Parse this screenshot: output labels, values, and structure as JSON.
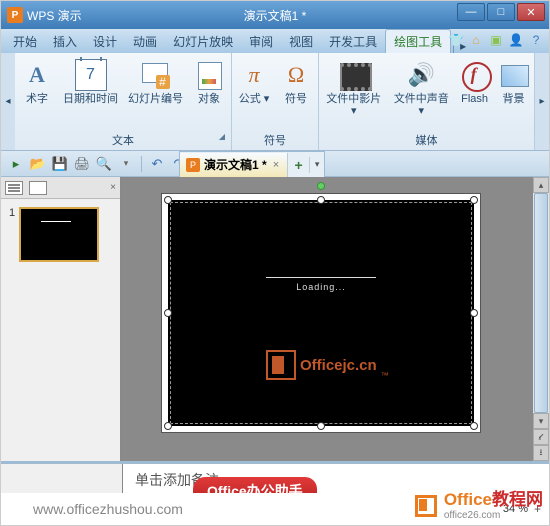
{
  "titlebar": {
    "app_name": "WPS 演示",
    "doc_title": "演示文稿1 *"
  },
  "tabs": {
    "items": [
      {
        "label": "开始",
        "active": false
      },
      {
        "label": "插入",
        "active": false
      },
      {
        "label": "设计",
        "active": false
      },
      {
        "label": "动画",
        "active": false
      },
      {
        "label": "幻灯片放映",
        "active": false
      },
      {
        "label": "审阅",
        "active": false
      },
      {
        "label": "视图",
        "active": false
      },
      {
        "label": "开发工具",
        "active": false
      },
      {
        "label": "绘图工具",
        "active": true
      }
    ]
  },
  "ribbon": {
    "groups": [
      {
        "label": "文本",
        "items": [
          {
            "icon": "textA",
            "label": "术字",
            "name": "wordart-button"
          },
          {
            "icon": "cal7",
            "label": "日期和时间",
            "name": "date-time-button"
          },
          {
            "icon": "slidenum",
            "label": "幻灯片编号",
            "name": "slide-number-button"
          },
          {
            "icon": "obj",
            "label": "对象",
            "name": "object-button"
          }
        ]
      },
      {
        "label": "符号",
        "items": [
          {
            "icon": "pi",
            "label": "公式",
            "name": "equation-button"
          },
          {
            "icon": "omega",
            "label": "符号",
            "name": "symbol-button"
          }
        ]
      },
      {
        "label": "媒体",
        "items": [
          {
            "icon": "film",
            "label": "文件中影片",
            "name": "movie-button"
          },
          {
            "icon": "spk",
            "label": "文件中声音",
            "name": "sound-button"
          },
          {
            "icon": "flash",
            "label": "Flash",
            "name": "flash-button"
          },
          {
            "icon": "bg",
            "label": "背景",
            "name": "background-button"
          }
        ]
      }
    ]
  },
  "doc_tab": {
    "label": "演示文稿1 *"
  },
  "thumb": {
    "num": "1"
  },
  "slide": {
    "loading": "Loading...",
    "watermark": "Officejc.cn",
    "wm_tm": "™"
  },
  "notes": {
    "placeholder": "单击添加备注"
  },
  "pill": {
    "text": "Office办公助手"
  },
  "status": {
    "url": "www.officezhushou.com",
    "zoom": "34 %"
  },
  "corner": {
    "brand_a": "Office",
    "brand_b": "教程网",
    "sub": "office26.com"
  }
}
